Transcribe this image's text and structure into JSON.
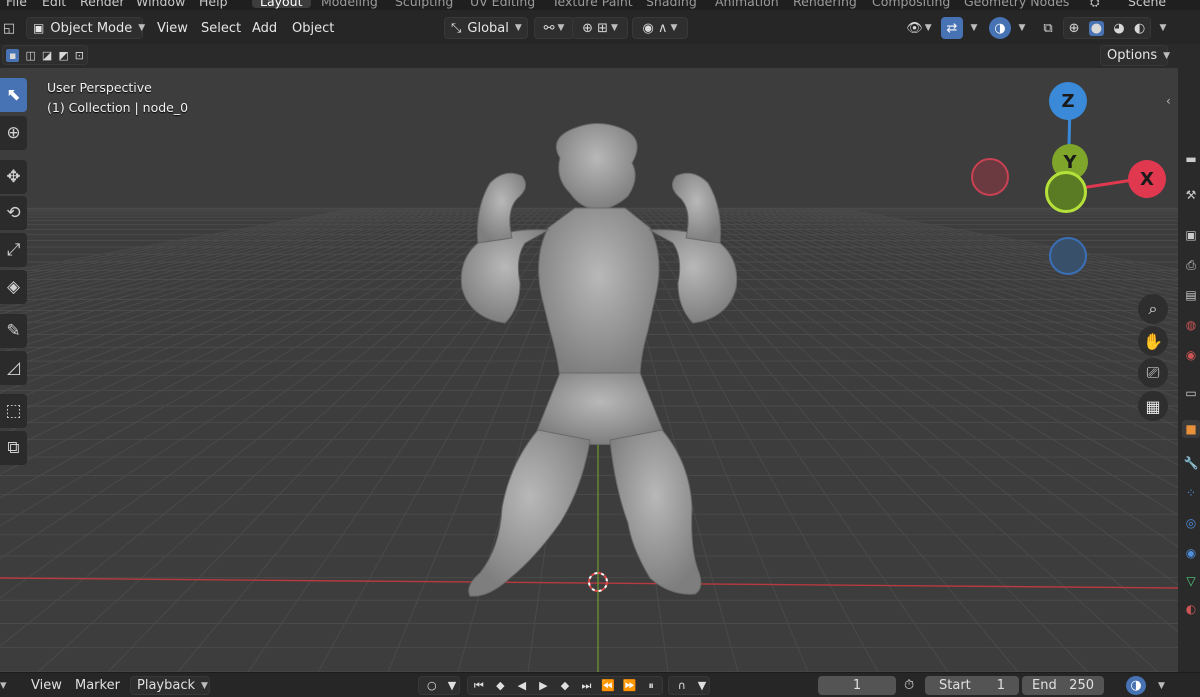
{
  "top_menu": {
    "items": [
      "File",
      "Edit",
      "Render",
      "Window",
      "Help"
    ],
    "workspaces": [
      "Layout",
      "Modeling",
      "Sculpting",
      "UV Editing",
      "Texture Paint",
      "Shading",
      "Animation",
      "Rendering",
      "Compositing",
      "Geometry Nodes"
    ],
    "active_workspace": "Layout",
    "scene": "Scene"
  },
  "header": {
    "mode": "Object Mode",
    "menus": [
      "View",
      "Select",
      "Add",
      "Object"
    ],
    "transform_orientation": "Global",
    "options_label": "Options"
  },
  "viewport": {
    "view_name": "User Perspective",
    "collection_info": "(1) Collection | node_0",
    "model": "sculpted bodybuilder figure",
    "gizmo_axes": [
      "Z",
      "Y",
      "X"
    ],
    "axis_colors": {
      "x": "#e0384f",
      "y": "#7fa52a",
      "z": "#3b8ad9"
    }
  },
  "toolbar": {
    "tools": [
      "select-box",
      "cursor",
      "move",
      "rotate",
      "scale",
      "transform",
      "annotate",
      "measure",
      "add-cube",
      "add-extras"
    ],
    "active_tool": "select-box"
  },
  "nav_buttons": [
    "zoom",
    "pan",
    "camera-view",
    "perspective-toggle"
  ],
  "timeline": {
    "menus": [
      "View",
      "Marker",
      "Playback"
    ],
    "current_frame": "1",
    "start_label": "Start",
    "start_value": "1",
    "end_label": "End",
    "end_value": "250"
  },
  "colors": {
    "accent": "#4772b3",
    "viewport_bg": "#3d3d3d",
    "header_bg": "#262626"
  }
}
